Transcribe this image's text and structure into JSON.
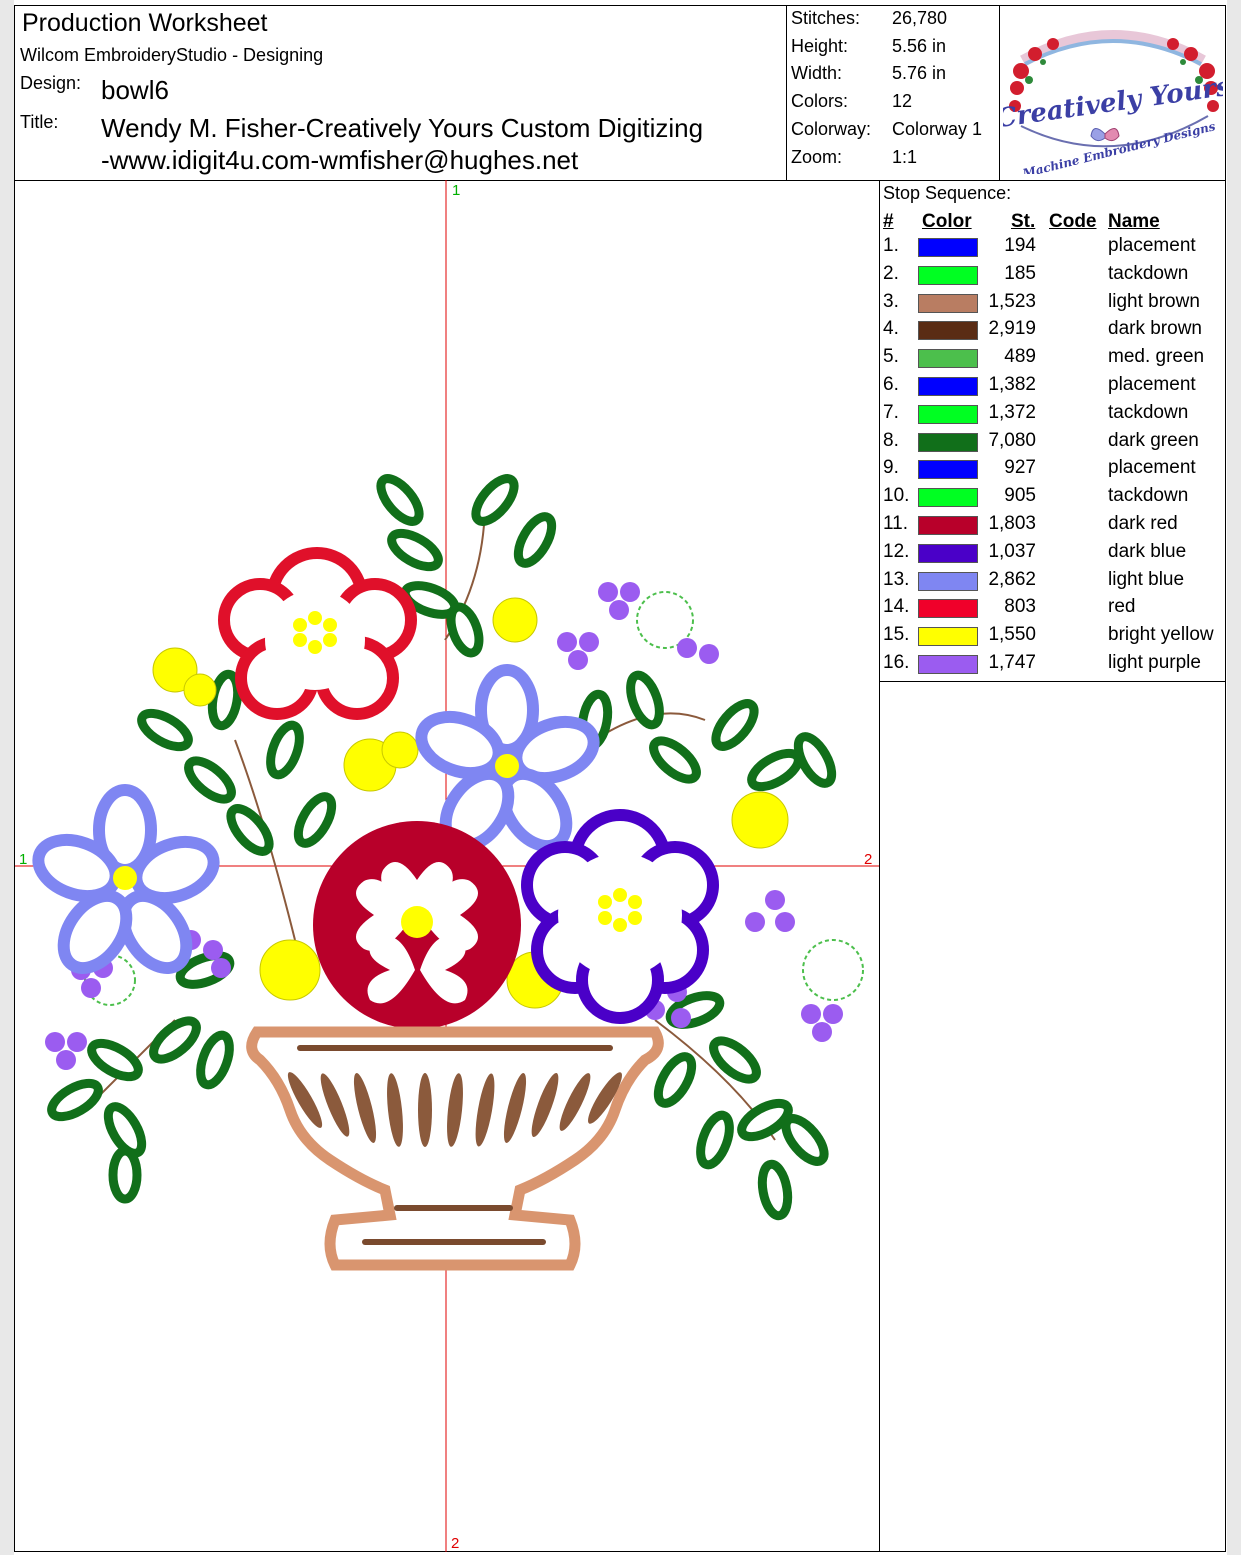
{
  "header": {
    "title": "Production Worksheet",
    "software": "Wilcom EmbroideryStudio - Designing",
    "design_label": "Design:",
    "design_value": "bowl6",
    "title_label": "Title:",
    "title_line1": "Wendy M. Fisher-Creatively Yours Custom Digitizing",
    "title_line2": "-www.idigit4u.com-wmfisher@hughes.net"
  },
  "stats": {
    "stitches_label": "Stitches:",
    "stitches": "26,780",
    "height_label": "Height:",
    "height": "5.56 in",
    "width_label": "Width:",
    "width": "5.76 in",
    "colors_label": "Colors:",
    "colors": "12",
    "colorway_label": "Colorway:",
    "colorway": "Colorway 1",
    "zoom_label": "Zoom:",
    "zoom": "1:1"
  },
  "logo": {
    "line1": "Creatively Yours",
    "line2": "Machine Embroidery Designs"
  },
  "stop_sequence": {
    "heading": "Stop Sequence:",
    "col_num": "#",
    "col_color": "Color",
    "col_st": "St.",
    "col_code": "Code",
    "col_name": "Name",
    "rows": [
      {
        "num": "1.",
        "color": "#0000ff",
        "st": "194",
        "name": "placement"
      },
      {
        "num": "2.",
        "color": "#00ff22",
        "st": "185",
        "name": "tackdown"
      },
      {
        "num": "3.",
        "color": "#b97d62",
        "st": "1,523",
        "name": "light brown"
      },
      {
        "num": "4.",
        "color": "#5a2c14",
        "st": "2,919",
        "name": "dark brown"
      },
      {
        "num": "5.",
        "color": "#4cbf4c",
        "st": "489",
        "name": "med. green"
      },
      {
        "num": "6.",
        "color": "#0000ff",
        "st": "1,382",
        "name": "placement"
      },
      {
        "num": "7.",
        "color": "#00ff22",
        "st": "1,372",
        "name": "tackdown"
      },
      {
        "num": "8.",
        "color": "#116f1a",
        "st": "7,080",
        "name": "dark green"
      },
      {
        "num": "9.",
        "color": "#0000ff",
        "st": "927",
        "name": "placement"
      },
      {
        "num": "10.",
        "color": "#00ff22",
        "st": "905",
        "name": "tackdown"
      },
      {
        "num": "11.",
        "color": "#b8002a",
        "st": "1,803",
        "name": "dark red"
      },
      {
        "num": "12.",
        "color": "#4a00c8",
        "st": "1,037",
        "name": "dark blue"
      },
      {
        "num": "13.",
        "color": "#7f86f2",
        "st": "2,862",
        "name": "light blue"
      },
      {
        "num": "14.",
        "color": "#f0002a",
        "st": "803",
        "name": "red"
      },
      {
        "num": "15.",
        "color": "#ffff00",
        "st": "1,550",
        "name": "bright yellow"
      },
      {
        "num": "16.",
        "color": "#9b5cf0",
        "st": "1,747",
        "name": "light purple"
      }
    ]
  },
  "canvas": {
    "axis_top": "1",
    "axis_left": "1",
    "axis_right": "2",
    "axis_bottom": "2"
  }
}
